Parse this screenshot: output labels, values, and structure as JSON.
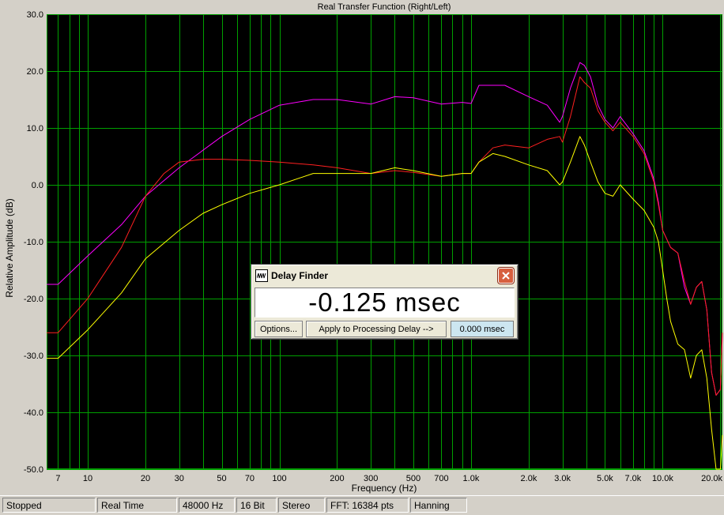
{
  "chart_data": {
    "type": "line",
    "title": "Real Transfer Function (Right/Left)",
    "xlabel": "Frequency (Hz)",
    "ylabel": "Relative Amplitude (dB)",
    "x_scale": "log",
    "xlim": [
      6.1,
      20500
    ],
    "ylim": [
      -50,
      30
    ],
    "grid": true,
    "legend": "none",
    "background": "#000000",
    "grid_color": "#00a000",
    "y_ticks": [
      "30.0",
      "20.0",
      "10.0",
      "0.0",
      "-10.0",
      "-20.0",
      "-30.0",
      "-40.0",
      "-50.0"
    ],
    "y_tick_values": [
      30,
      20,
      10,
      0,
      -10,
      -20,
      -30,
      -40,
      -50
    ],
    "x_ticks": [
      "7",
      "10",
      "20",
      "30",
      "50",
      "70",
      "100",
      "200",
      "300",
      "500",
      "700",
      "1.0k",
      "2.0k",
      "3.0k",
      "5.0k",
      "7.0k",
      "10.0k",
      "20.0k"
    ],
    "x_tick_values": [
      7,
      10,
      20,
      30,
      50,
      70,
      100,
      200,
      300,
      500,
      700,
      1000,
      2000,
      3000,
      5000,
      7000,
      10000,
      20000
    ],
    "series": [
      {
        "color": "#ff00ff",
        "x": [
          6,
          7,
          10,
          15,
          20,
          30,
          50,
          70,
          100,
          150,
          200,
          300,
          400,
          500,
          700,
          900,
          1000,
          1100,
          1500,
          2000,
          2500,
          2900,
          3000,
          3300,
          3700,
          3900,
          4200,
          4600,
          5000,
          5500,
          6000,
          7000,
          8000,
          9000,
          9500,
          10000,
          11000,
          12000,
          13000,
          14000,
          15000,
          16000,
          17000,
          18000,
          19000,
          20000,
          20500
        ],
        "y": [
          -17.5,
          -17.5,
          -12.5,
          -7,
          -2,
          3,
          8.5,
          11.5,
          14,
          15,
          15,
          14.2,
          15.5,
          15.3,
          14.2,
          14.5,
          14.3,
          17.5,
          17.5,
          15.5,
          14,
          11,
          12,
          17,
          21.5,
          21,
          19,
          14,
          11.5,
          10,
          12,
          9,
          6,
          1,
          -3,
          -8,
          -11,
          -12,
          -18,
          -21,
          -18,
          -17,
          -22,
          -33,
          -37,
          -36,
          -26
        ]
      },
      {
        "color": "#ff2020",
        "x": [
          6,
          7,
          10,
          15,
          20,
          25,
          30,
          40,
          50,
          70,
          100,
          150,
          200,
          300,
          400,
          500,
          700,
          900,
          1000,
          1100,
          1300,
          1500,
          2000,
          2500,
          2900,
          3000,
          3300,
          3700,
          3900,
          4200,
          4600,
          5000,
          5500,
          6000,
          7000,
          8000,
          9000,
          9500,
          10000,
          11000,
          12000,
          13000,
          14000,
          15000,
          16000,
          17000,
          18000,
          19000,
          20000,
          20500
        ],
        "y": [
          -26,
          -26,
          -20,
          -11,
          -2,
          2,
          4,
          4.5,
          4.5,
          4.3,
          4,
          3.5,
          3,
          2,
          2.5,
          2.2,
          1.5,
          2,
          2,
          4,
          6.5,
          7,
          6.5,
          8,
          8.5,
          7.5,
          12,
          19,
          18,
          17,
          13,
          11,
          9.5,
          11,
          8.5,
          5.5,
          0.5,
          -3.5,
          -8,
          -11,
          -12,
          -17,
          -21,
          -18,
          -17,
          -22,
          -33,
          -37,
          -36,
          -26
        ]
      },
      {
        "color": "#ffff00",
        "x": [
          6,
          7,
          10,
          15,
          20,
          30,
          40,
          50,
          70,
          100,
          150,
          200,
          300,
          400,
          500,
          700,
          900,
          1000,
          1100,
          1300,
          1500,
          2000,
          2500,
          2900,
          3000,
          3300,
          3700,
          3900,
          4200,
          4600,
          5000,
          5500,
          6000,
          7000,
          8000,
          9000,
          9500,
          10000,
          10500,
          11000,
          12000,
          13000,
          14000,
          15000,
          16000,
          17000,
          18000,
          19000,
          20000,
          20500
        ],
        "y": [
          -30.5,
          -30.5,
          -25.5,
          -19,
          -13,
          -8,
          -5,
          -3.5,
          -1.5,
          0,
          2,
          2,
          2,
          3,
          2.5,
          1.5,
          2,
          2,
          4,
          5.5,
          5,
          3.5,
          2.5,
          0,
          0.5,
          4,
          8.5,
          7,
          4,
          0.5,
          -1.5,
          -2,
          0,
          -2.5,
          -4.5,
          -7.5,
          -10,
          -15,
          -20,
          -24,
          -28,
          -29,
          -34,
          -30,
          -29,
          -34,
          -43,
          -50,
          -50,
          -44
        ]
      }
    ]
  },
  "dialog": {
    "title": "Delay Finder",
    "value": "-0.125 msec",
    "options_label": "Options...",
    "apply_label": "Apply to Processing Delay -->",
    "delay_field": "0.000 msec"
  },
  "statusbar": {
    "state": "Stopped",
    "mode": "Real Time",
    "sample_rate": "48000 Hz",
    "bit_depth": "16 Bit",
    "channels": "Stereo",
    "fft": "FFT: 16384 pts",
    "window": "Hanning"
  }
}
